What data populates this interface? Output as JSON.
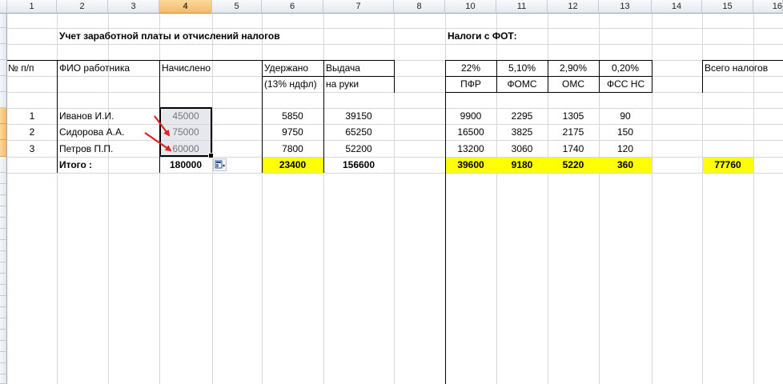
{
  "columns": [
    "1",
    "2",
    "3",
    "4",
    "5",
    "6",
    "7",
    "8",
    "10",
    "11",
    "12",
    "13",
    "14",
    "15",
    "16"
  ],
  "header": {
    "title": "Учет заработной платы и отчислений налогов",
    "tax_title": "Налоги с ФОТ:",
    "no": "№ п/п",
    "fio": "ФИО работника",
    "accrued": "Начислено",
    "withheld_1": "Удержано",
    "withheld_2": "(13% ндфл)",
    "payout_1": "Выдача",
    "payout_2": "на руки",
    "total_taxes": "Всего налогов"
  },
  "taxes": [
    {
      "rate": "22%",
      "name": "ПФР"
    },
    {
      "rate": "5,10%",
      "name": "ФОМС"
    },
    {
      "rate": "2,90%",
      "name": "ОМС"
    },
    {
      "rate": "0,20%",
      "name": "ФСС НС"
    }
  ],
  "rows": [
    {
      "no": "1",
      "fio": "Иванов И.И.",
      "accrued": "45000",
      "withheld": "5850",
      "payout": "39150",
      "pfr": "9900",
      "foms": "2295",
      "oms": "1305",
      "fss": "90"
    },
    {
      "no": "2",
      "fio": "Сидорова А.А.",
      "accrued": "75000",
      "withheld": "9750",
      "payout": "65250",
      "pfr": "16500",
      "foms": "3825",
      "oms": "2175",
      "fss": "150"
    },
    {
      "no": "3",
      "fio": "Петров П.П.",
      "accrued": "60000",
      "withheld": "7800",
      "payout": "52200",
      "pfr": "13200",
      "foms": "3060",
      "oms": "1740",
      "fss": "120"
    }
  ],
  "totals": {
    "label": "Итого :",
    "accrued": "180000",
    "withheld": "23400",
    "payout": "156600",
    "pfr": "39600",
    "foms": "9180",
    "oms": "5220",
    "fss": "360",
    "all_taxes": "77760"
  },
  "colors": {
    "highlight": "#ffff00",
    "arrow": "#e02020",
    "selected_header": "#f5b96a"
  }
}
